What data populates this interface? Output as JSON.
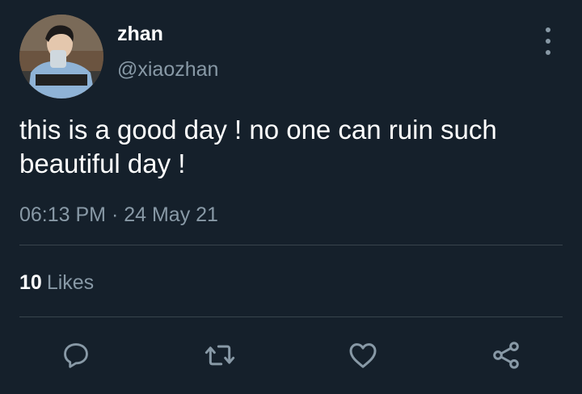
{
  "tweet": {
    "display_name": "zhan",
    "handle": "@xiaozhan",
    "text": "this is a good day ! no one can ruin such beautiful day !",
    "timestamp": "06:13 PM · 24 May 21",
    "likes_count": "10",
    "likes_label": "Likes"
  },
  "icons": {
    "more": "more-vertical-icon",
    "reply": "reply-icon",
    "retweet": "retweet-icon",
    "like": "heart-icon",
    "share": "share-icon"
  },
  "colors": {
    "background": "#15202b",
    "text_primary": "#ffffff",
    "text_secondary": "#8899a6",
    "divider": "#38444d"
  }
}
